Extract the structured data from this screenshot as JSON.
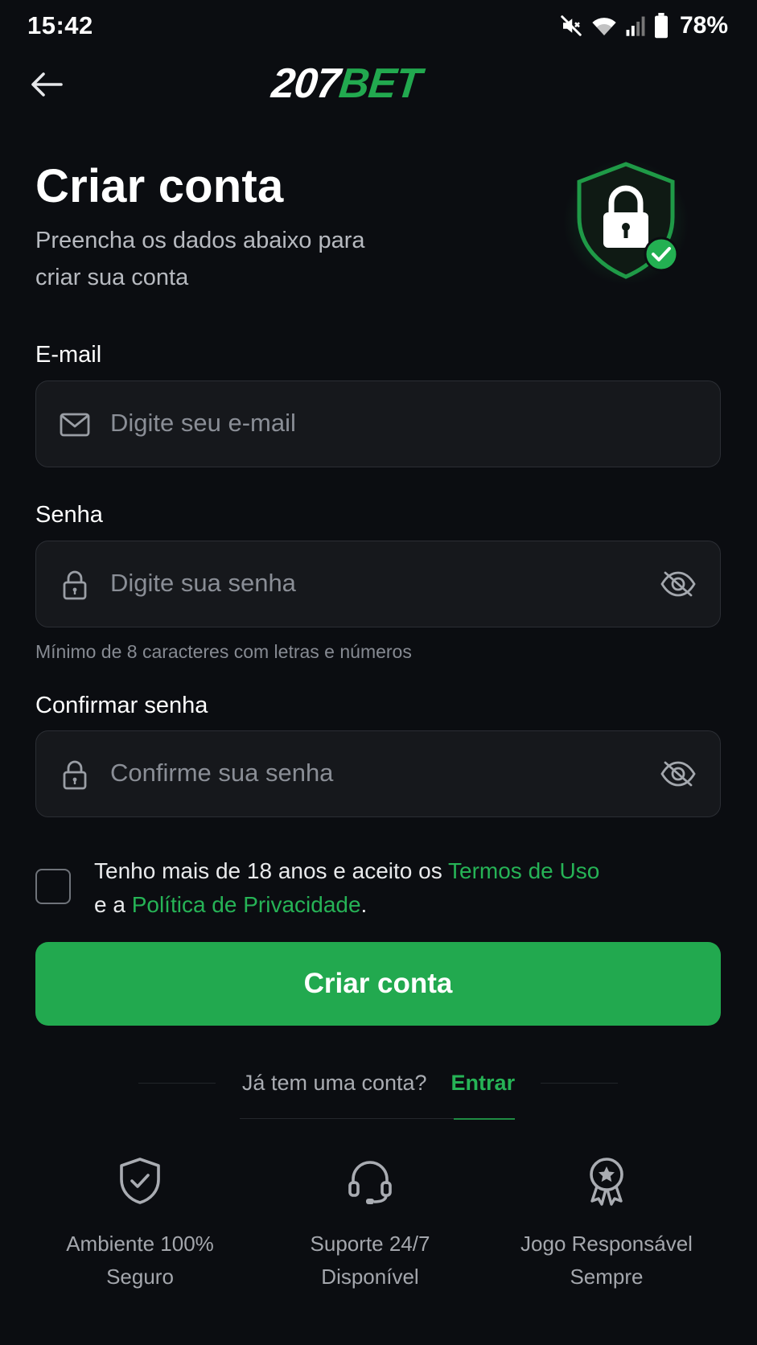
{
  "status_bar": {
    "time": "15:42",
    "battery": "78%",
    "icons": [
      "mute-icon",
      "wifi-icon",
      "signal-icon",
      "battery-icon"
    ]
  },
  "header": {
    "logo_number": "207",
    "logo_brand": "BET",
    "back_icon": "arrow-left-icon"
  },
  "heading": {
    "title": "Criar conta",
    "subtitle": "Preencha os dados abaixo para criar sua conta"
  },
  "form": {
    "email": {
      "label": "E-mail",
      "placeholder": "Digite seu e-mail",
      "value": ""
    },
    "password": {
      "label": "Senha",
      "placeholder": "Digite sua senha",
      "value": "",
      "hint": "Mínimo de 8 caracteres com letras e números"
    },
    "confirm_password": {
      "label": "Confirmar senha",
      "placeholder": "Confirme sua senha",
      "value": ""
    },
    "terms": {
      "text_before": "Tenho mais de 18 anos e aceito os ",
      "terms_link": "Termos de Uso",
      "text_middle": " e a ",
      "privacy_link": "Política de Privacidade",
      "text_after": ".",
      "checked": false
    },
    "submit_label": "Criar conta"
  },
  "login": {
    "question": "Já tem uma conta?",
    "link": "Entrar"
  },
  "features": [
    {
      "icon": "shield-check-icon",
      "line1": "Ambiente 100%",
      "line2": "Seguro"
    },
    {
      "icon": "headset-icon",
      "line1": "Suporte 24/7",
      "line2": "Disponível"
    },
    {
      "icon": "award-icon",
      "line1": "Jogo Responsável",
      "line2": "Sempre"
    }
  ],
  "colors": {
    "background": "#0b0d11",
    "accent": "#22a94f",
    "field_background": "#16181c",
    "field_border": "#2b2e34"
  }
}
